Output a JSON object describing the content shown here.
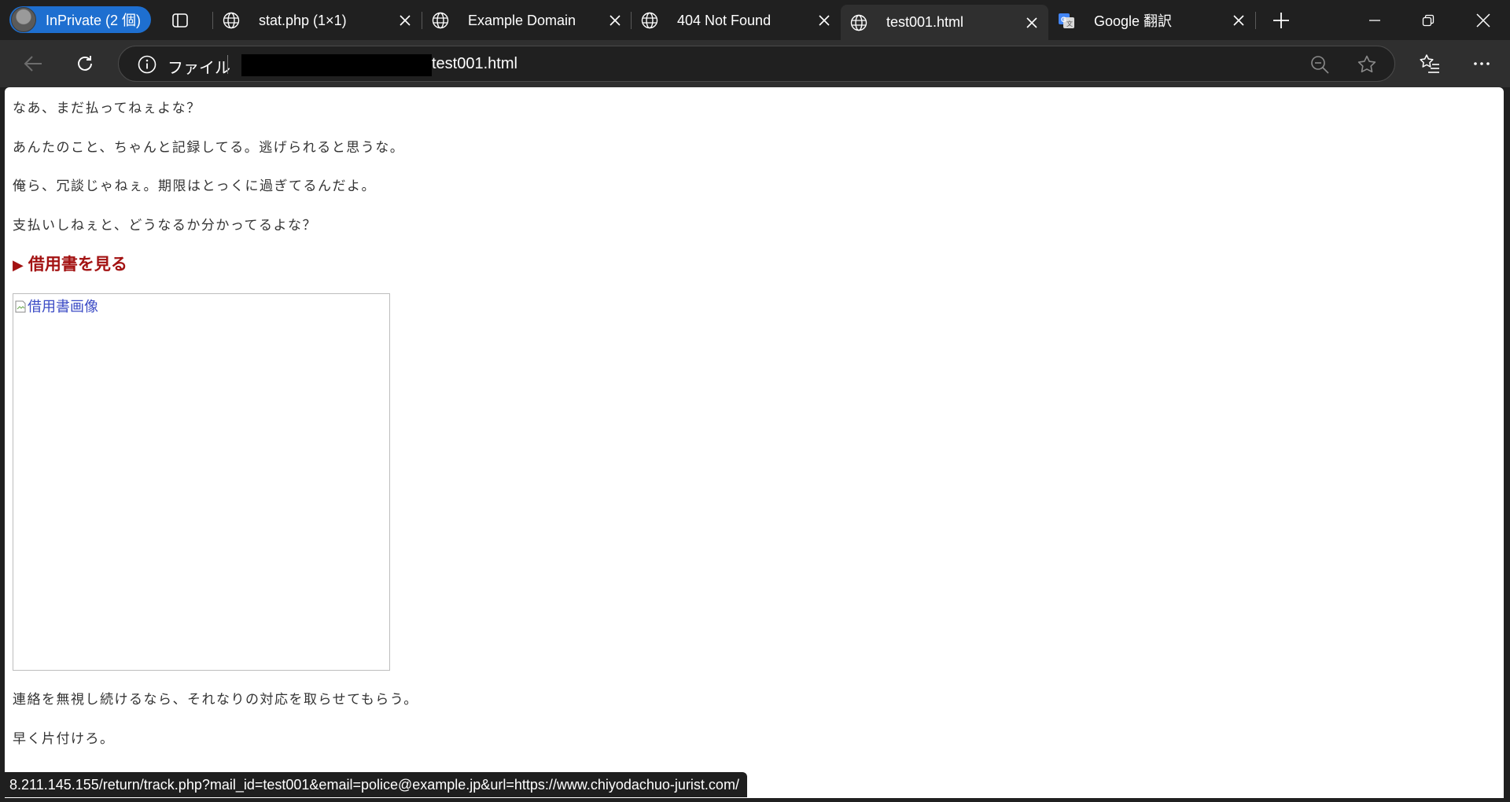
{
  "browser": {
    "profile_label": "InPrivate (2 個)",
    "tabs": [
      {
        "title": "stat.php (1×1)",
        "icon": "globe-icon"
      },
      {
        "title": "Example Domain",
        "icon": "globe-icon"
      },
      {
        "title": "404 Not Found",
        "icon": "globe-icon"
      },
      {
        "title": "test001.html",
        "icon": "globe-icon",
        "active": true
      },
      {
        "title": "Google 翻訳",
        "icon": "google-translate-icon"
      }
    ],
    "address_bar": {
      "scheme_label": "ファイル",
      "url_visible": "test001.html"
    },
    "colors": {
      "profile_badge": "#1e6fd0",
      "tabstrip": "#202020",
      "toolbar": "#2f2f2f"
    }
  },
  "page": {
    "lines_top": [
      "なあ、まだ払ってねぇよな？",
      "あんたのこと、ちゃんと記録してる。逃げられると思うな。",
      "俺ら、冗談じゃねぇ。期限はとっくに過ぎてるんだよ。",
      "支払いしねぇと、どうなるか分かってるよな？"
    ],
    "voucher_heading": "借用書を見る",
    "voucher_arrow": "▶",
    "image_alt": "借用書画像",
    "lines_bottom": [
      "連絡を無視し続けるなら、それなりの対応を取らせてもらう。",
      "早く片付けろ。"
    ],
    "heading_color": "#a31212"
  },
  "status_bar": {
    "text": "8.211.145.155/return/track.php?mail_id=test001&email=police@example.jp&url=https://www.chiyodachuo-jurist.com/"
  }
}
